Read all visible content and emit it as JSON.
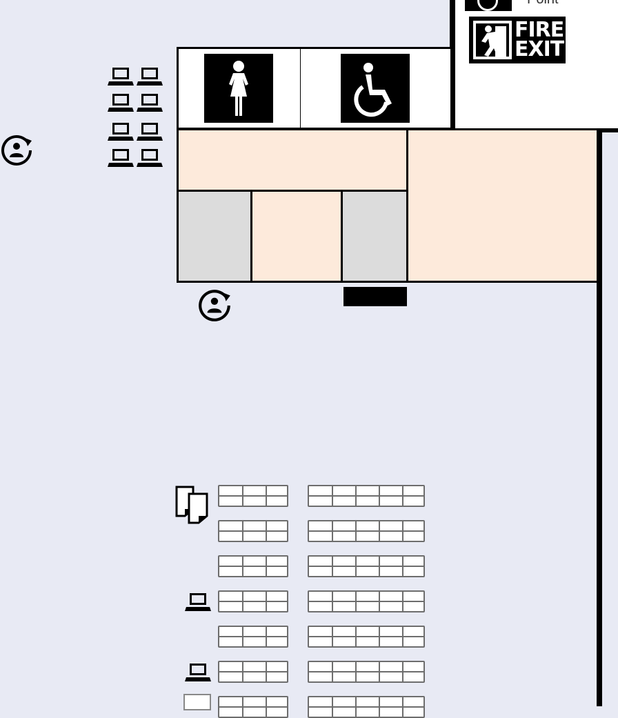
{
  "signage": {
    "fire_exit_line1": "FIRE",
    "fire_exit_line2": "EXIT",
    "assembly_point_partial": "Point"
  },
  "icons": {
    "toilet": "female-toilet-icon",
    "accessible": "accessible-toilet-icon",
    "reset_point": "help-point-icon",
    "laptop": "laptop-icon",
    "printer": "printer-copier-icon",
    "fire_exit": "fire-exit-icon"
  },
  "colors": {
    "floor": "#e8eaf4",
    "room_fill": "#fdeadb",
    "service_fill": "#dcdcdc",
    "wall": "#000000"
  }
}
